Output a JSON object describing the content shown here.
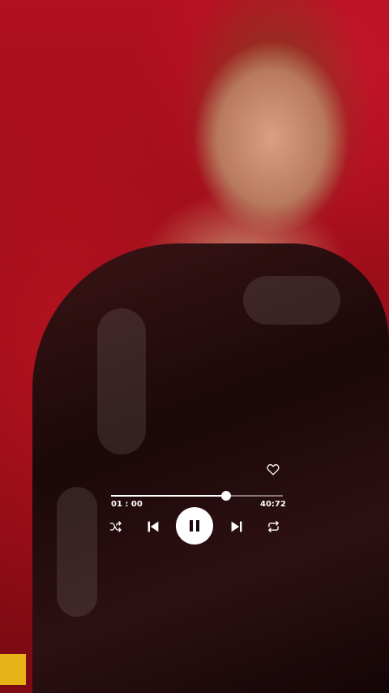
{
  "player": {
    "elapsed": "01 : 00",
    "total": "40:72",
    "progress_fraction": 0.67,
    "liked": false,
    "state": "playing"
  },
  "icons": {
    "like": "heart-outline-icon",
    "shuffle": "shuffle-icon",
    "previous": "skip-previous-icon",
    "pause": "pause-icon",
    "next": "skip-next-icon",
    "repeat": "repeat-icon"
  },
  "colors": {
    "controls": "#ffffff",
    "background_accent": "#b01020"
  }
}
